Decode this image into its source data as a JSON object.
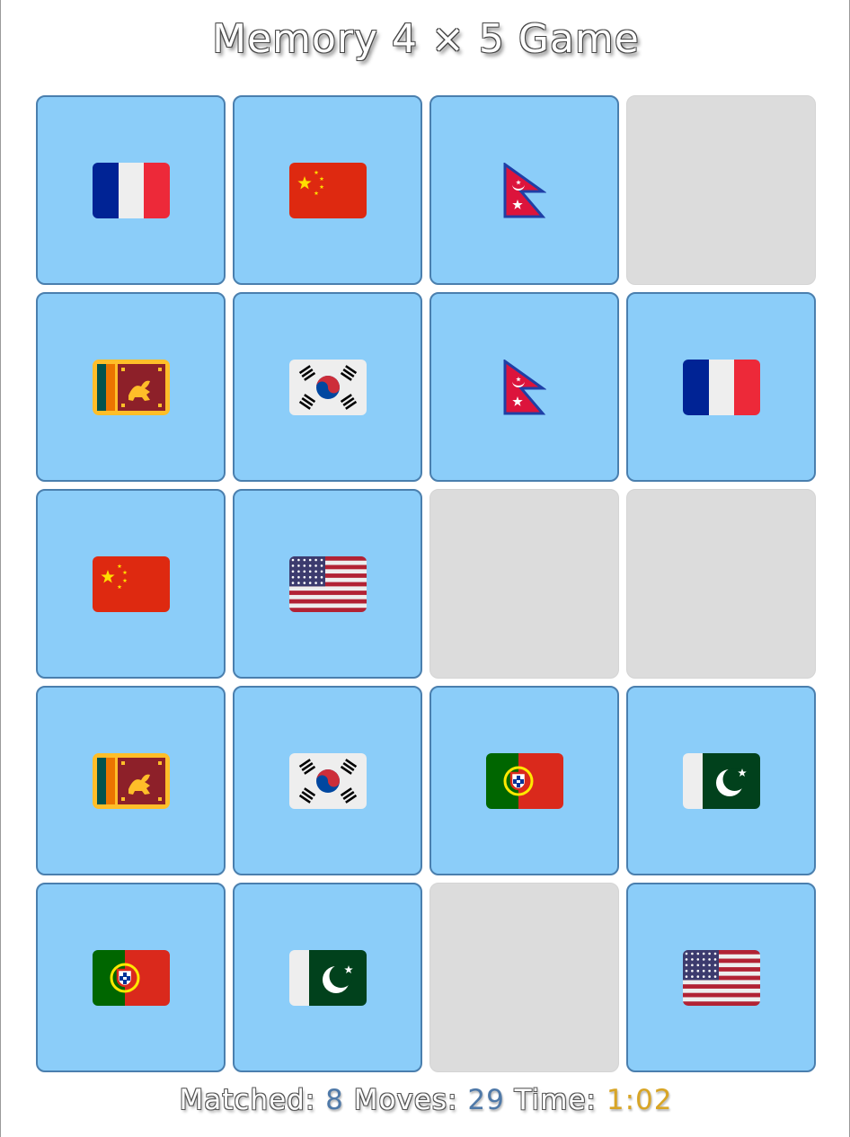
{
  "title": "Memory 4 × 5 Game",
  "board": {
    "columns": 4,
    "rows": 5,
    "cards": [
      {
        "state": "face-up",
        "flag": "france"
      },
      {
        "state": "face-up",
        "flag": "china"
      },
      {
        "state": "face-up",
        "flag": "nepal"
      },
      {
        "state": "removed",
        "flag": ""
      },
      {
        "state": "face-up",
        "flag": "sri-lanka"
      },
      {
        "state": "face-up",
        "flag": "south-korea"
      },
      {
        "state": "face-up",
        "flag": "nepal"
      },
      {
        "state": "face-up",
        "flag": "france"
      },
      {
        "state": "face-up",
        "flag": "china"
      },
      {
        "state": "face-up",
        "flag": "usa"
      },
      {
        "state": "removed",
        "flag": ""
      },
      {
        "state": "removed",
        "flag": ""
      },
      {
        "state": "face-up",
        "flag": "sri-lanka"
      },
      {
        "state": "face-up",
        "flag": "south-korea"
      },
      {
        "state": "face-up",
        "flag": "portugal"
      },
      {
        "state": "face-up",
        "flag": "pakistan"
      },
      {
        "state": "face-up",
        "flag": "portugal"
      },
      {
        "state": "face-up",
        "flag": "pakistan"
      },
      {
        "state": "removed",
        "flag": ""
      },
      {
        "state": "face-up",
        "flag": "usa"
      }
    ]
  },
  "status": {
    "matched_label": "Matched:",
    "matched_value": "8",
    "moves_label": "Moves:",
    "moves_value": "29",
    "time_label": "Time:",
    "time_value": "1:02"
  },
  "colors": {
    "card_face": "#8bcdf9",
    "card_border": "#4a7fae",
    "card_removed": "#dcdcdc",
    "value_blue": "#4f79a8",
    "value_gold": "#d8a526"
  }
}
